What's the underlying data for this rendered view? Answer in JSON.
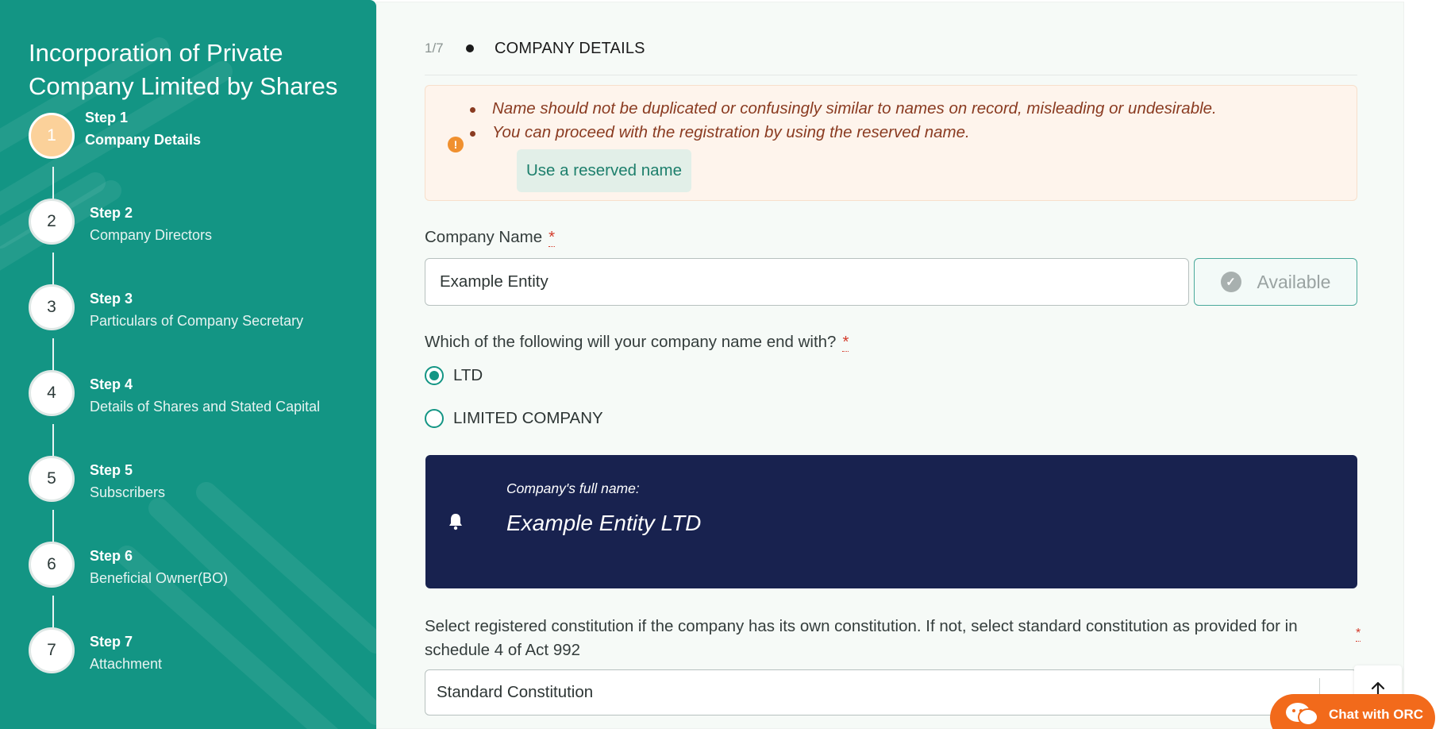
{
  "sidebar": {
    "title": "Incorporation of Private Company Limited by Shares",
    "steps": [
      {
        "number": "1",
        "step": "Step 1",
        "label": "Company Details",
        "state": "active"
      },
      {
        "number": "2",
        "step": "Step 2",
        "label": "Company Directors",
        "state": "pending"
      },
      {
        "number": "3",
        "step": "Step 3",
        "label": "Particulars of Company Secretary",
        "state": "pending"
      },
      {
        "number": "4",
        "step": "Step 4",
        "label": "Details of Shares and Stated Capital",
        "state": "pending"
      },
      {
        "number": "5",
        "step": "Step 5",
        "label": "Subscribers",
        "state": "pending"
      },
      {
        "number": "6",
        "step": "Step 6",
        "label": "Beneficial Owner(BO)",
        "state": "pending"
      },
      {
        "number": "7",
        "step": "Step 7",
        "label": "Attachment",
        "state": "pending"
      }
    ]
  },
  "header": {
    "counter": "1/7",
    "title": "COMPANY DETAILS"
  },
  "notice": {
    "icon": "warning-icon",
    "items": [
      "Name should not be duplicated or confusingly similar to names on record, misleading or undesirable.",
      "You can proceed with the registration by using the reserved name."
    ],
    "button_label": "Use a reserved name"
  },
  "company_name": {
    "label": "Company Name",
    "required_marker": "*",
    "value": "Example Entity",
    "availability_label": "Available"
  },
  "suffix": {
    "question": "Which of the following will your company name end with?",
    "required_marker": "*",
    "options": [
      {
        "label": "LTD",
        "selected": true
      },
      {
        "label": "LIMITED COMPANY",
        "selected": false
      }
    ]
  },
  "full_name": {
    "caption": "Company's full name:",
    "value": "Example Entity LTD"
  },
  "constitution": {
    "label": "Select registered constitution if the company has its own constitution. If not, select standard constitution as provided for in schedule 4 of Act 992",
    "required_marker": "*",
    "selected_value": "Standard Constitution"
  },
  "chat": {
    "label": "Chat with ORC"
  },
  "colors": {
    "sidebar_bg": "#139584",
    "accent": "#139584",
    "active_step": "#fbd19a",
    "notice_bg": "#fef4ec",
    "notice_text": "#8a3b21",
    "fullname_card_bg": "#18224f",
    "chat_bg": "#f26a1b",
    "required": "#d33b2b"
  }
}
